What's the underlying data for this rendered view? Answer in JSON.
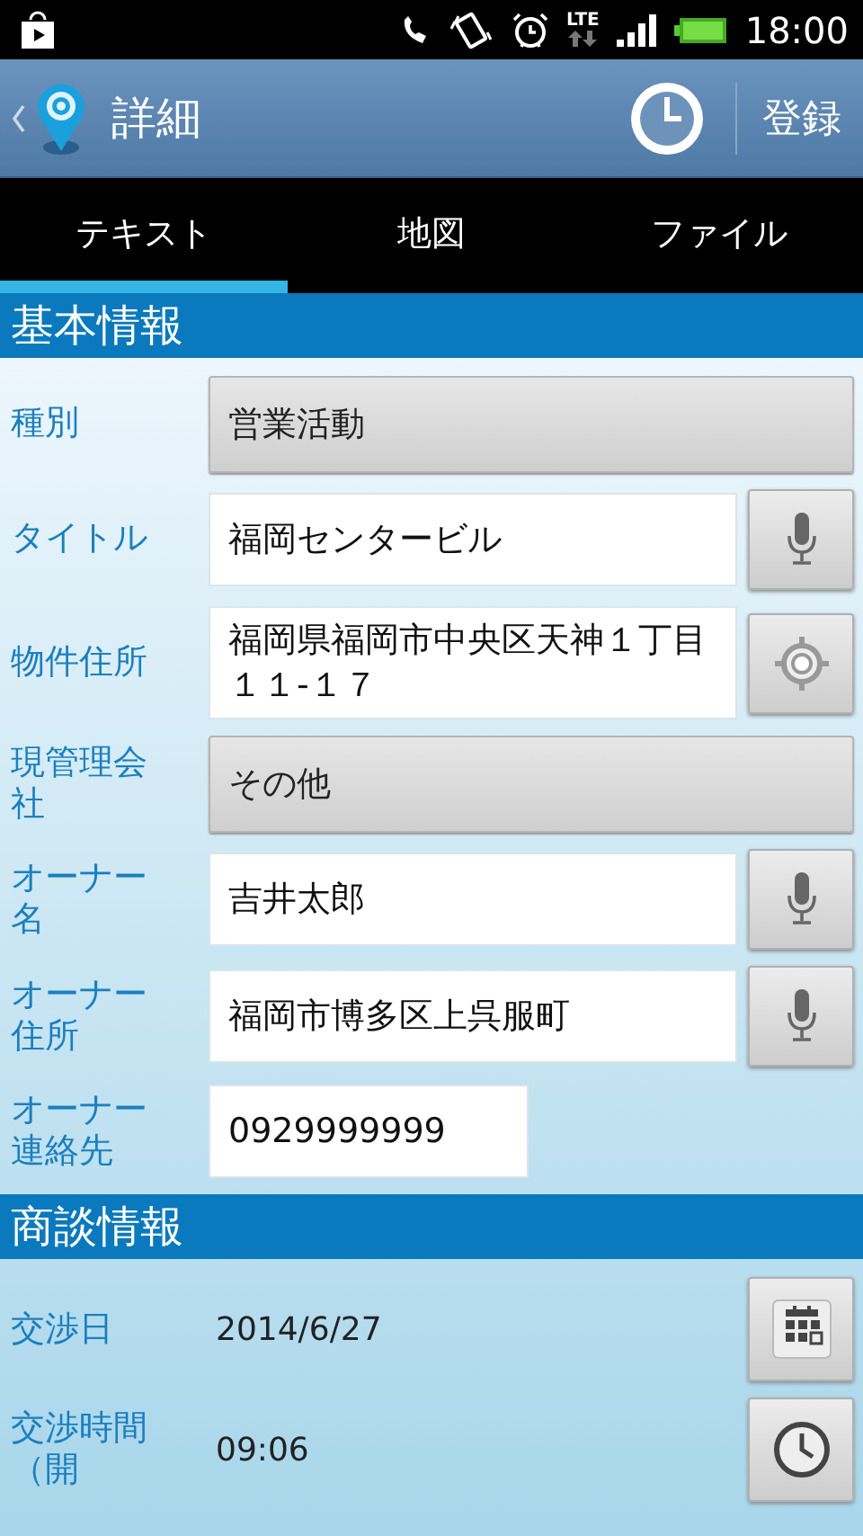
{
  "status_bar": {
    "network": "LTE",
    "time": "18:00"
  },
  "action_bar": {
    "title": "詳細",
    "action": "登録"
  },
  "tabs": [
    {
      "label": "テキスト",
      "selected": true
    },
    {
      "label": "地図",
      "selected": false
    },
    {
      "label": "ファイル",
      "selected": false
    }
  ],
  "sections": [
    {
      "title": "基本情報",
      "rows": [
        {
          "label": "種別",
          "kind": "select",
          "value": "営業活動"
        },
        {
          "label": "タイトル",
          "kind": "text",
          "value": "福岡センタービル",
          "button": {
            "kind": "mic"
          }
        },
        {
          "label": "物件住所",
          "kind": "text",
          "value": "福岡県福岡市中央区天神１丁目１１-１７",
          "button": {
            "kind": "locate"
          }
        },
        {
          "label": "現管理会社",
          "kind": "select",
          "value": "その他"
        },
        {
          "label": "オーナー名",
          "kind": "text",
          "value": "吉井太郎",
          "button": {
            "kind": "mic"
          }
        },
        {
          "label": "オーナー住所",
          "kind": "text",
          "value": "福岡市博多区上呉服町",
          "button": {
            "kind": "mic"
          }
        },
        {
          "label": "オーナー連絡先",
          "kind": "short",
          "value": "0929999999"
        }
      ]
    },
    {
      "title": "商談情報",
      "rows": [
        {
          "label": "交渉日",
          "kind": "plain",
          "value": "2014/6/27",
          "button": {
            "kind": "calendar"
          }
        },
        {
          "label": "交渉時間（開",
          "kind": "plain",
          "value": "09:06",
          "button": {
            "kind": "clock"
          }
        }
      ]
    }
  ]
}
